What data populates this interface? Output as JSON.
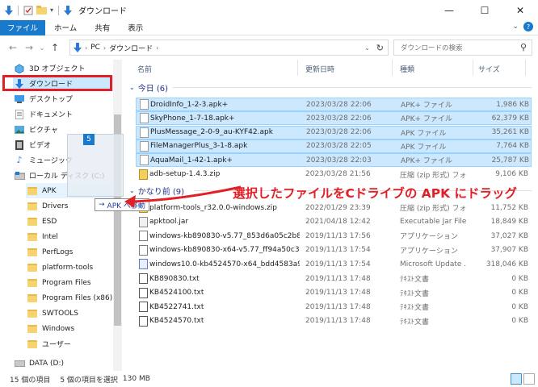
{
  "window": {
    "title": "ダウンロード",
    "minimize": "—",
    "maximize": "☐",
    "close": "✕"
  },
  "ribbon": {
    "tabs": [
      "ファイル",
      "ホーム",
      "共有",
      "表示"
    ]
  },
  "address": {
    "path": [
      "PC",
      "ダウンロード"
    ],
    "search_placeholder": "ダウンロードの検索"
  },
  "nav": {
    "items": [
      {
        "label": "3D オブジェクト",
        "icon": "3d-objects-icon"
      },
      {
        "label": "ダウンロード",
        "icon": "download-icon"
      },
      {
        "label": "デスクトップ",
        "icon": "desktop-icon"
      },
      {
        "label": "ドキュメント",
        "icon": "documents-icon"
      },
      {
        "label": "ピクチャ",
        "icon": "pictures-icon"
      },
      {
        "label": "ビデオ",
        "icon": "videos-icon"
      },
      {
        "label": "ミュージック",
        "icon": "music-icon"
      },
      {
        "label": "ローカル ディスク (C:)",
        "icon": "local-disk-icon"
      },
      {
        "label": "APK",
        "icon": "folder-icon"
      },
      {
        "label": "Drivers",
        "icon": "folder-icon"
      },
      {
        "label": "ESD",
        "icon": "folder-icon"
      },
      {
        "label": "Intel",
        "icon": "folder-icon"
      },
      {
        "label": "PerfLogs",
        "icon": "folder-icon"
      },
      {
        "label": "platform-tools",
        "icon": "folder-icon"
      },
      {
        "label": "Program Files",
        "icon": "folder-icon"
      },
      {
        "label": "Program Files (x86)",
        "icon": "folder-icon"
      },
      {
        "label": "SWTOOLS",
        "icon": "folder-icon"
      },
      {
        "label": "Windows",
        "icon": "folder-icon"
      },
      {
        "label": "ユーザー",
        "icon": "folder-icon"
      },
      {
        "label": "DATA (D:)",
        "icon": "drive-icon"
      }
    ]
  },
  "columns": {
    "name": "名前",
    "date": "更新日時",
    "type": "種類",
    "size": "サイズ"
  },
  "groups": {
    "today": "今日 (6)",
    "earlier": "かなり前 (9)"
  },
  "files_today": [
    {
      "name": "DroidInfo_1-2-3.apk+",
      "date": "2023/03/28 22:06",
      "type": "APK+ ファイル",
      "size": "1,986 KB",
      "selected": true,
      "icon": "apk"
    },
    {
      "name": "SkyPhone_1-7-18.apk+",
      "date": "2023/03/28 22:06",
      "type": "APK+ ファイル",
      "size": "62,379 KB",
      "selected": true,
      "icon": "apk"
    },
    {
      "name": "PlusMessage_2-0-9_au-KYF42.apk",
      "date": "2023/03/28 22:06",
      "type": "APK ファイル",
      "size": "35,261 KB",
      "selected": true,
      "icon": "apk"
    },
    {
      "name": "FileManagerPlus_3-1-8.apk",
      "date": "2023/03/28 22:05",
      "type": "APK ファイル",
      "size": "7,764 KB",
      "selected": true,
      "icon": "apk"
    },
    {
      "name": "AquaMail_1-42-1.apk+",
      "date": "2023/03/28 22:03",
      "type": "APK+ ファイル",
      "size": "25,787 KB",
      "selected": true,
      "icon": "apk"
    },
    {
      "name": "adb-setup-1.4.3.zip",
      "date": "2023/03/28 21:56",
      "type": "圧縮 (zip 形式) フォ...",
      "size": "9,106 KB",
      "selected": false,
      "icon": "zip"
    }
  ],
  "files_earlier": [
    {
      "name": "platform-tools_r32.0.0-windows.zip",
      "date": "2022/01/29 23:39",
      "type": "圧縮 (zip 形式) フォ...",
      "size": "11,752 KB",
      "icon": "zip"
    },
    {
      "name": "apktool.jar",
      "date": "2021/04/18 12:42",
      "type": "Executable Jar File",
      "size": "18,849 KB",
      "icon": "jar"
    },
    {
      "name": "windows-kb890830-v5.77_853d6a05c2b8...",
      "date": "2019/11/13 17:56",
      "type": "アプリケーション",
      "size": "37,027 KB",
      "icon": "exe"
    },
    {
      "name": "windows-kb890830-x64-v5.77_ff94a50c30...",
      "date": "2019/11/13 17:54",
      "type": "アプリケーション",
      "size": "37,907 KB",
      "icon": "exe"
    },
    {
      "name": "windows10.0-kb4524570-x64_bdd4583a9f...",
      "date": "2019/11/13 17:54",
      "type": "Microsoft Update ...",
      "size": "318,046 KB",
      "icon": "msu"
    },
    {
      "name": "KB890830.txt",
      "date": "2019/11/13 17:48",
      "type": "ﾃｷｽﾄ文書",
      "size": "0 KB",
      "icon": "txt"
    },
    {
      "name": "KB4524100.txt",
      "date": "2019/11/13 17:48",
      "type": "ﾃｷｽﾄ文書",
      "size": "0 KB",
      "icon": "txt"
    },
    {
      "name": "KB4522741.txt",
      "date": "2019/11/13 17:48",
      "type": "ﾃｷｽﾄ文書",
      "size": "0 KB",
      "icon": "txt"
    },
    {
      "name": "KB4524570.txt",
      "date": "2019/11/13 17:48",
      "type": "ﾃｷｽﾄ文書",
      "size": "0 KB",
      "icon": "txt"
    }
  ],
  "status": {
    "count": "15 個の項目",
    "selection": "5 個の項目を選択",
    "size": "130 MB"
  },
  "drag": {
    "badge": "5",
    "tooltip_arrow": "→",
    "tooltip_text": "APK へ移動"
  },
  "annotation": "選択したファイルをCドライブの APK にドラッグ",
  "colors": {
    "accent": "#1979ca",
    "selection": "#cce8ff",
    "annotation": "#e21f26"
  }
}
